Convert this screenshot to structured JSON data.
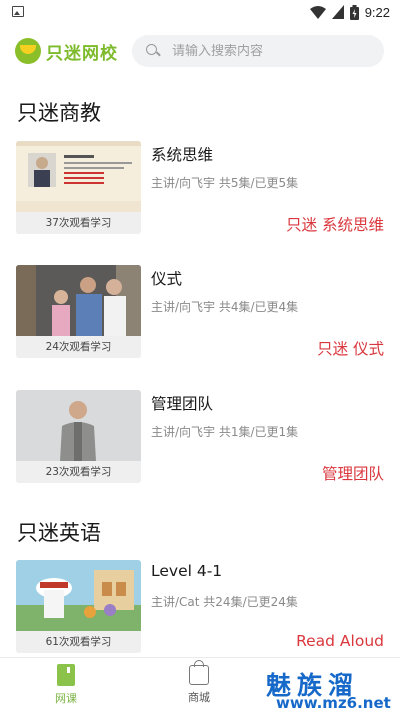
{
  "status_bar": {
    "time": "9:22",
    "icons": [
      "image-icon",
      "wifi-icon",
      "sim-icon",
      "battery-icon"
    ]
  },
  "header": {
    "logo_text": "只迷网校",
    "search_placeholder": "请输入搜索内容"
  },
  "sections": [
    {
      "title": "只迷商教",
      "courses": [
        {
          "title": "系统思维",
          "meta": "主讲/向飞宇 共5集/已更5集",
          "views": "37次观看学习",
          "tag": "只迷 系统思维"
        },
        {
          "title": "仪式",
          "meta": "主讲/向飞宇 共4集/已更4集",
          "views": "24次观看学习",
          "tag": "只迷 仪式"
        },
        {
          "title": "管理团队",
          "meta": "主讲/向飞宇 共1集/已更1集",
          "views": "23次观看学习",
          "tag": "管理团队"
        }
      ]
    },
    {
      "title": "只迷英语",
      "courses": [
        {
          "title": "Level 4-1",
          "meta": "主讲/Cat 共24集/已更24集",
          "views": "61次观看学习",
          "tag": "Read Aloud"
        }
      ]
    }
  ],
  "bottom_nav": {
    "items": [
      {
        "label": "网课",
        "icon": "book-icon",
        "active": true
      },
      {
        "label": "商城",
        "icon": "shopping-bag-icon",
        "active": false
      }
    ]
  },
  "watermark": {
    "top": "魅族溜",
    "bottom": "www.mz6.net"
  },
  "colors": {
    "brand_green": "#7dbb2c",
    "accent_red": "#d9373d",
    "watermark_blue": "#1769c9"
  }
}
